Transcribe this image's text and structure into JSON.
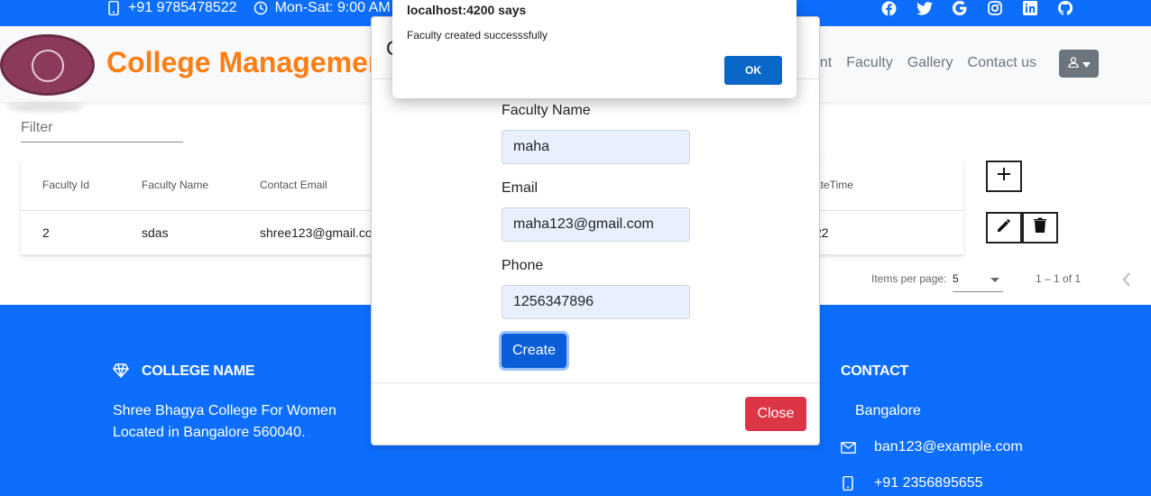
{
  "topbar": {
    "phone": "+91 9785478522",
    "hours": "Mon-Sat: 9:00 AM -",
    "social_icons": [
      "facebook-icon",
      "twitter-icon",
      "google-icon",
      "instagram-icon",
      "linkedin-icon",
      "github-icon"
    ]
  },
  "navbar": {
    "brand": "College Management",
    "links": [
      "ent",
      "Faculty",
      "Gallery",
      "Contact us"
    ],
    "user_icon": "user-icon"
  },
  "filter": {
    "placeholder": "Filter"
  },
  "table": {
    "headers": [
      "Faculty Id",
      "Faculty Name",
      "Contact Email",
      "ateTime"
    ],
    "row": {
      "id": "2",
      "name": "sdas",
      "email": "shree123@gmail.co",
      "datetime": "22"
    }
  },
  "paginator": {
    "items_per_page_label": "Items per page:",
    "items_per_page": "5",
    "range": "1 – 1 of 1"
  },
  "modal": {
    "title": "C",
    "faculty_name_label": "Faculty Name",
    "faculty_name_value": "maha",
    "email_label": "Email",
    "email_value": "maha123@gmail.com",
    "phone_label": "Phone",
    "phone_value": "1256347896",
    "create_label": "Create",
    "close_label": "Close"
  },
  "alert": {
    "title": "localhost:4200 says",
    "message": "Faculty created successsfully",
    "ok_label": "OK"
  },
  "footer": {
    "college_heading": "COLLEGE NAME",
    "college_line1": "Shree Bhagya College For Women",
    "college_line2": "Located in Bangalore 560040.",
    "contact_heading": "CONTACT",
    "city": "Bangalore",
    "email": "ban123@example.com",
    "phone": "+91 2356895655"
  },
  "colors": {
    "primary": "#0d6efd",
    "brand_orange": "#fd7e14",
    "danger": "#dc3545",
    "input_fill": "#e8f0fe"
  }
}
